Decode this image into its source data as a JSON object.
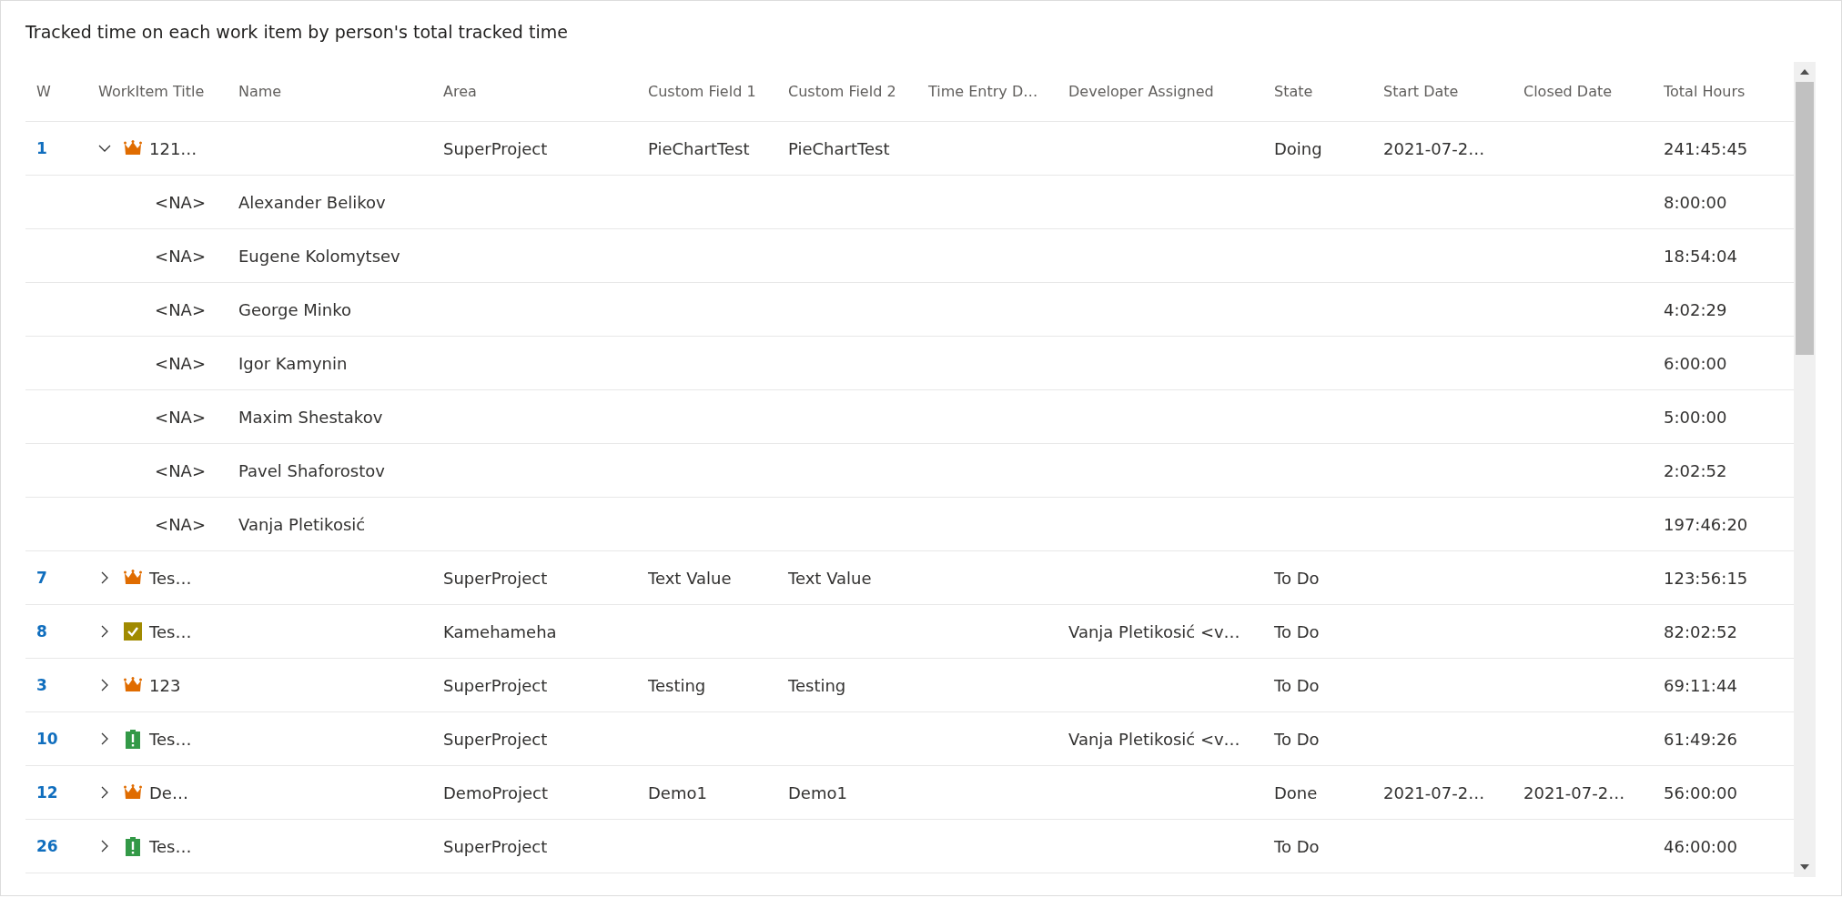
{
  "title": "Tracked time on each work item by person's total tracked time",
  "columns": [
    "W",
    "WorkItem Title",
    "Name",
    "Area",
    "Custom Field 1",
    "Custom Field 2",
    "Time Entry D…",
    "Developer Assigned",
    "State",
    "Start Date",
    "Closed Date",
    "Total Hours"
  ],
  "rows": [
    {
      "kind": "epic",
      "id": "1",
      "expanded": true,
      "title": "121…",
      "area": "SuperProject",
      "custom_field_1": "PieChartTest",
      "custom_field_2": "PieChartTest",
      "state": "Doing",
      "start_date": "2021-07-2…",
      "total_hours": "241:45:45"
    },
    {
      "kind": "person",
      "title": "<NA>",
      "name": "Alexander Belikov",
      "total_hours": "8:00:00"
    },
    {
      "kind": "person",
      "title": "<NA>",
      "name": "Eugene Kolomytsev",
      "total_hours": "18:54:04"
    },
    {
      "kind": "person",
      "title": "<NA>",
      "name": "George Minko",
      "total_hours": "4:02:29"
    },
    {
      "kind": "person",
      "title": "<NA>",
      "name": "Igor Kamynin",
      "total_hours": "6:00:00"
    },
    {
      "kind": "person",
      "title": "<NA>",
      "name": "Maxim Shestakov",
      "total_hours": "5:00:00"
    },
    {
      "kind": "person",
      "title": "<NA>",
      "name": "Pavel Shaforostov",
      "total_hours": "2:02:52"
    },
    {
      "kind": "person",
      "title": "<NA>",
      "name": "Vanja Pletikosić",
      "total_hours": "197:46:20"
    },
    {
      "kind": "epic",
      "id": "7",
      "expanded": false,
      "title": "Tes…",
      "area": "SuperProject",
      "custom_field_1": "Text Value",
      "custom_field_2": "Text Value",
      "state": "To Do",
      "total_hours": "123:56:15"
    },
    {
      "kind": "task",
      "id": "8",
      "expanded": false,
      "title": "Tes…",
      "area": "Kamehameha",
      "developer_assigned": "Vanja Pletikosić <v…",
      "state": "To Do",
      "total_hours": "82:02:52"
    },
    {
      "kind": "epic",
      "id": "3",
      "expanded": false,
      "title": "123",
      "area": "SuperProject",
      "custom_field_1": "Testing",
      "custom_field_2": "Testing",
      "state": "To Do",
      "total_hours": "69:11:44"
    },
    {
      "kind": "issue",
      "id": "10",
      "expanded": false,
      "title": "Tes…",
      "area": "SuperProject",
      "developer_assigned": "Vanja Pletikosić <v…",
      "state": "To Do",
      "total_hours": "61:49:26"
    },
    {
      "kind": "epic",
      "id": "12",
      "expanded": false,
      "title": "De…",
      "area": "DemoProject",
      "custom_field_1": "Demo1",
      "custom_field_2": "Demo1",
      "state": "Done",
      "start_date": "2021-07-2…",
      "closed_date": "2021-07-2…",
      "total_hours": "56:00:00"
    },
    {
      "kind": "issue",
      "id": "26",
      "expanded": false,
      "title": "Tes…",
      "area": "SuperProject",
      "state": "To Do",
      "total_hours": "46:00:00"
    }
  ]
}
